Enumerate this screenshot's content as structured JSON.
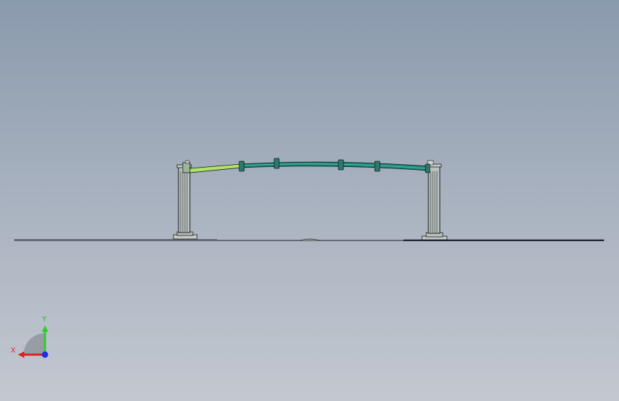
{
  "viewport": {
    "background_top": "#8a9aad",
    "background_bottom": "#c3c8d0"
  },
  "model": {
    "colors": {
      "outline": "#1a1a1a",
      "post_fill": "#b8c2bd",
      "arm_main": "#1e8a7a",
      "arm_tip": "#aee36a",
      "ground_line": "#20253a"
    }
  },
  "triad": {
    "x_label": "X",
    "y_label": "Y",
    "colors": {
      "x_axis": "#e02020",
      "y_axis": "#2ecc2e",
      "z_axis": "#2030e0"
    }
  }
}
